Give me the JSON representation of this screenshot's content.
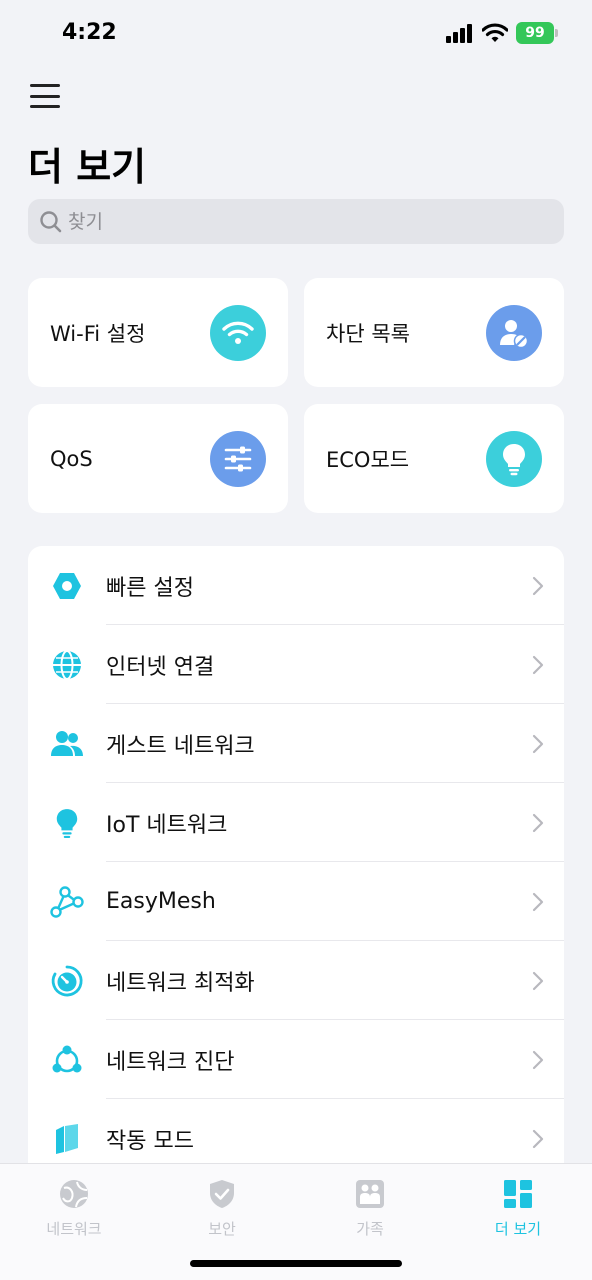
{
  "status": {
    "time": "4:22",
    "battery": "99"
  },
  "header": {
    "title": "더 보기"
  },
  "search": {
    "placeholder": "찾기"
  },
  "cards": [
    {
      "label": "Wi-Fi 설정",
      "icon": "wifi-icon",
      "color": "#3CCFDB"
    },
    {
      "label": "차단 목록",
      "icon": "blocked-user-icon",
      "color": "#6B9DEB"
    },
    {
      "label": "QoS",
      "icon": "sliders-icon",
      "color": "#6B9DEB"
    },
    {
      "label": "ECO모드",
      "icon": "lightbulb-icon",
      "color": "#3CCFDB"
    }
  ],
  "list": [
    {
      "label": "빠른 설정",
      "icon": "hexagon-icon"
    },
    {
      "label": "인터넷 연결",
      "icon": "globe-icon"
    },
    {
      "label": "게스트 네트워크",
      "icon": "guests-icon"
    },
    {
      "label": "IoT 네트워크",
      "icon": "lightbulb-icon"
    },
    {
      "label": "EasyMesh",
      "icon": "mesh-icon"
    },
    {
      "label": "네트워크 최적화",
      "icon": "optimize-icon"
    },
    {
      "label": "네트워크 진단",
      "icon": "diagnose-icon"
    },
    {
      "label": "작동 모드",
      "icon": "mode-icon"
    }
  ],
  "tabs": [
    {
      "label": "네트워크",
      "icon": "globe-icon",
      "active": false
    },
    {
      "label": "보안",
      "icon": "shield-icon",
      "active": false
    },
    {
      "label": "가족",
      "icon": "family-icon",
      "active": false
    },
    {
      "label": "더 보기",
      "icon": "grid-icon",
      "active": true
    }
  ],
  "colors": {
    "accent": "#1EC3E0",
    "card_teal": "#3CCFDB",
    "card_blue": "#6B9DEB",
    "inactive": "#C2C4CA"
  }
}
